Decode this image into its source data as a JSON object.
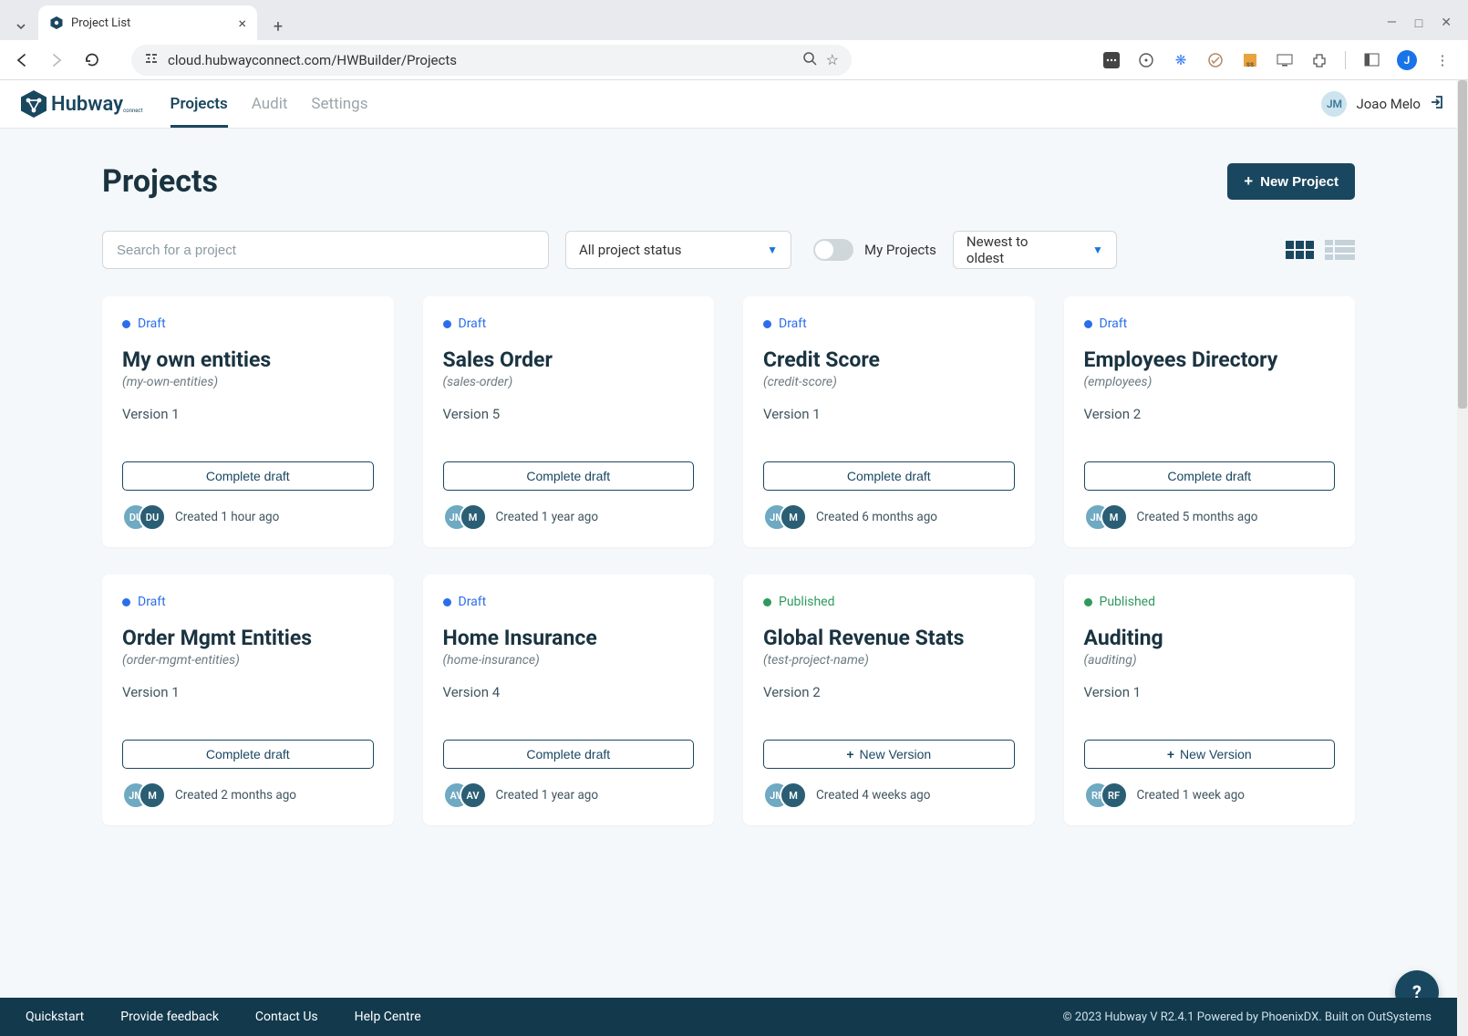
{
  "browser": {
    "tab_title": "Project List",
    "url": "cloud.hubwayconnect.com/HWBuilder/Projects",
    "profile_initial": "J"
  },
  "nav": {
    "brand": "Hubway",
    "brand_sub": "connect",
    "tabs": [
      "Projects",
      "Audit",
      "Settings"
    ],
    "active_tab": "Projects",
    "user_initials": "JM",
    "user_name": "Joao Melo"
  },
  "page": {
    "title": "Projects",
    "new_project_label": "New Project",
    "search_placeholder": "Search for a project",
    "status_filter": "All project status",
    "my_projects_label": "My Projects",
    "sort_value": "Newest to oldest"
  },
  "cards": [
    {
      "status": "Draft",
      "status_class": "draft",
      "title": "My own entities",
      "slug": "(my-own-entities)",
      "version": "Version 1",
      "action": "Complete draft",
      "action_icon": "",
      "avatars": [
        "DU",
        "DU"
      ],
      "created": "Created 1 hour ago"
    },
    {
      "status": "Draft",
      "status_class": "draft",
      "title": "Sales Order",
      "slug": "(sales-order)",
      "version": "Version 5",
      "action": "Complete draft",
      "action_icon": "",
      "avatars": [
        "JM",
        "M"
      ],
      "created": "Created 1 year ago"
    },
    {
      "status": "Draft",
      "status_class": "draft",
      "title": "Credit Score",
      "slug": "(credit-score)",
      "version": "Version 1",
      "action": "Complete draft",
      "action_icon": "",
      "avatars": [
        "JM",
        "M"
      ],
      "created": "Created 6 months ago"
    },
    {
      "status": "Draft",
      "status_class": "draft",
      "title": "Employees Directory",
      "slug": "(employees)",
      "version": "Version 2",
      "action": "Complete draft",
      "action_icon": "",
      "avatars": [
        "JM",
        "M"
      ],
      "created": "Created 5 months ago"
    },
    {
      "status": "Draft",
      "status_class": "draft",
      "title": "Order Mgmt Entities",
      "slug": "(order-mgmt-entities)",
      "version": "Version 1",
      "action": "Complete draft",
      "action_icon": "",
      "avatars": [
        "JM",
        "M"
      ],
      "created": "Created 2 months ago"
    },
    {
      "status": "Draft",
      "status_class": "draft",
      "title": "Home Insurance",
      "slug": "(home-insurance)",
      "version": "Version 4",
      "action": "Complete draft",
      "action_icon": "",
      "avatars": [
        "AV",
        "AV"
      ],
      "created": "Created 1 year ago"
    },
    {
      "status": "Published",
      "status_class": "published",
      "title": "Global Revenue Stats",
      "slug": "(test-project-name)",
      "version": "Version 2",
      "action": "New Version",
      "action_icon": "+",
      "avatars": [
        "JM",
        "M"
      ],
      "created": "Created 4 weeks ago"
    },
    {
      "status": "Published",
      "status_class": "published",
      "title": "Auditing",
      "slug": "(auditing)",
      "version": "Version 1",
      "action": "New Version",
      "action_icon": "+",
      "avatars": [
        "RF",
        "RF"
      ],
      "created": "Created 1 week ago"
    }
  ],
  "footer": {
    "links": [
      "Quickstart",
      "Provide feedback",
      "Contact Us",
      "Help Centre"
    ],
    "copyright": "© 2023 Hubway V R2.4.1 Powered by PhoenixDX. Built on OutSystems"
  },
  "help_label": "?"
}
